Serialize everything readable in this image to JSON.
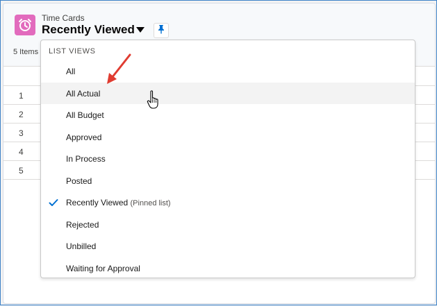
{
  "header": {
    "object_label": "Time Cards",
    "list_title": "Recently Viewed",
    "item_count": "5 Items"
  },
  "icons": {
    "object_icon": "alarm-clock-icon",
    "title_caret": "caret-down-icon",
    "pin": "pin-icon",
    "selected": "checkmark-icon"
  },
  "colors": {
    "object_icon_bg": "#e26bbd",
    "accent": "#0070d2",
    "annotation_arrow": "#e03c31"
  },
  "table": {
    "rows": [
      "1",
      "2",
      "3",
      "4",
      "5"
    ]
  },
  "dropdown": {
    "heading": "LIST VIEWS",
    "items": [
      {
        "label": "All",
        "sub": ""
      },
      {
        "label": "All Actual",
        "sub": ""
      },
      {
        "label": "All Budget",
        "sub": ""
      },
      {
        "label": "Approved",
        "sub": ""
      },
      {
        "label": "In Process",
        "sub": ""
      },
      {
        "label": "Posted",
        "sub": ""
      },
      {
        "label": "Recently Viewed",
        "sub": "(Pinned list)"
      },
      {
        "label": "Rejected",
        "sub": ""
      },
      {
        "label": "Unbilled",
        "sub": ""
      },
      {
        "label": "Waiting for Approval",
        "sub": ""
      }
    ],
    "hovered_index": 1,
    "selected_index": 6
  }
}
